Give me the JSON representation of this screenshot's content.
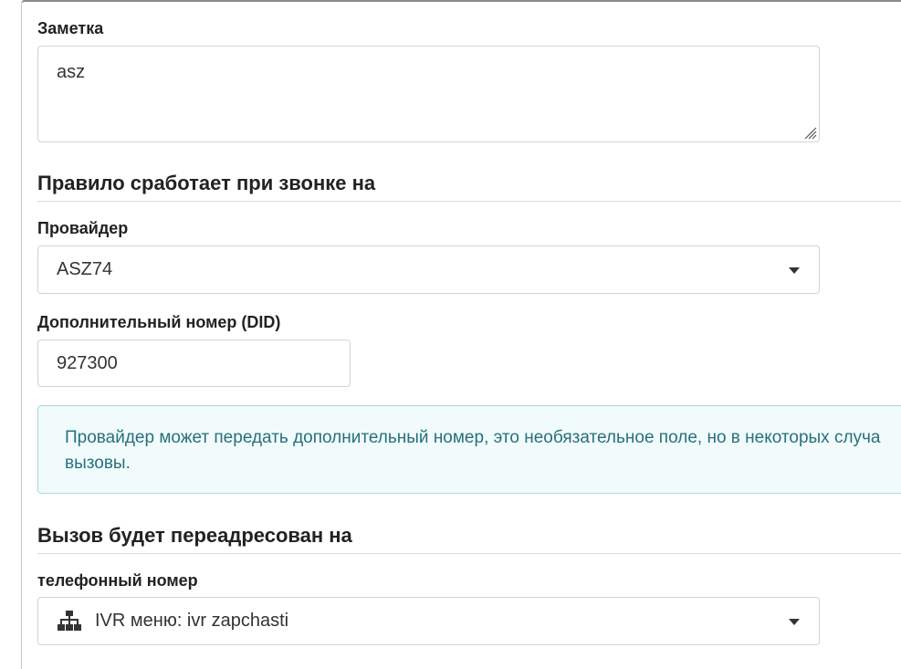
{
  "note": {
    "label": "Заметка",
    "value": "asz"
  },
  "trigger_section": {
    "title": "Правило сработает при звонке на"
  },
  "provider": {
    "label": "Провайдер",
    "selected": "ASZ74"
  },
  "did": {
    "label": "Дополнительный номер (DID)",
    "value": "927300"
  },
  "info": {
    "line1": "Провайдер может передать дополнительный номер, это необязательное поле, но в некоторых случа",
    "line2": "вызовы."
  },
  "forward_section": {
    "title": "Вызов будет переадресован на"
  },
  "destination": {
    "label": "телефонный номер",
    "selected": "IVR меню: ivr zapchasti",
    "icon": "sitemap-icon"
  }
}
